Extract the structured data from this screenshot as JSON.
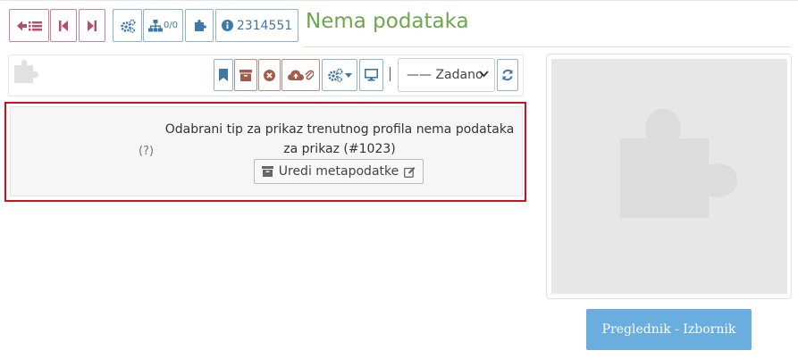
{
  "header": {
    "title": "Nema podataka",
    "hierarchy_count": "0/0",
    "record_id": "2314551"
  },
  "toolbar": {
    "view_select": {
      "selected": "—— Zadano"
    }
  },
  "message": {
    "help": "(?)",
    "text": "Odabrani tip za prikaz trenutnog profila nema podataka za prikaz (#1023)",
    "edit_button_label": "Uredi metapodatke"
  },
  "preview": {
    "browser_button_label": "Preglednik - Izbornik"
  },
  "icons": [
    "back-to-list-icon",
    "first-record-icon",
    "last-record-icon",
    "cogs-icon",
    "hierarchy-icon",
    "puzzle-icon",
    "info-icon",
    "bookmark-icon",
    "archive-icon",
    "remove-icon",
    "cloud-upload-icon",
    "paperclip-icon",
    "monitor-icon",
    "refresh-icon",
    "pencil-icon"
  ],
  "colors": {
    "title_green": "#6ca74b",
    "nav_red": "#b0506c",
    "action_blue": "#3d79a8",
    "alert_border": "#d0101e",
    "browse_button": "#6aaee0"
  }
}
